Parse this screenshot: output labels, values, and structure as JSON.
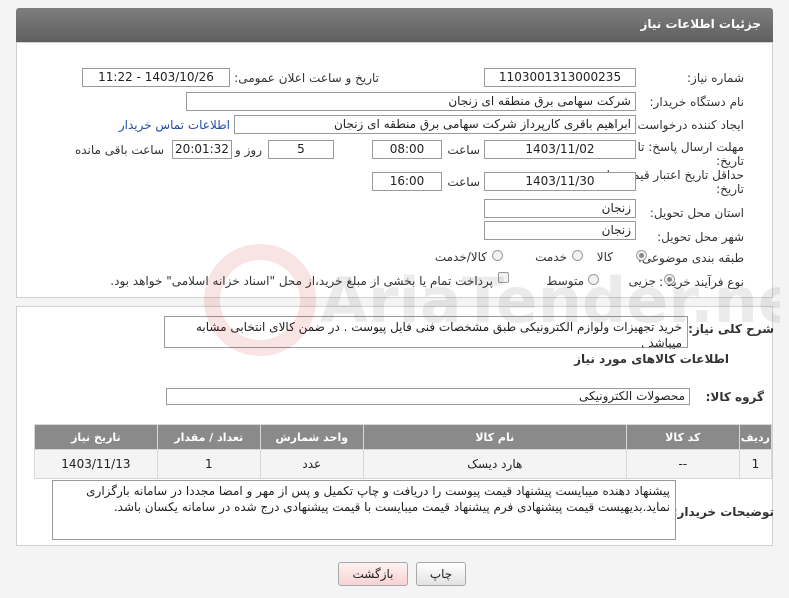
{
  "header": {
    "title": "جزئیات اطلاعات نیاز"
  },
  "form": {
    "need_number": {
      "label": "شماره نیاز:",
      "value": "1103001313000235"
    },
    "announce_datetime": {
      "label": "تاریخ و ساعت اعلان عمومی:",
      "value": "1403/10/26 - 11:22"
    },
    "buyer_org": {
      "label": "نام دستگاه خریدار:",
      "value": "شرکت سهامی برق منطقه ای زنجان"
    },
    "requester": {
      "label": "ایجاد کننده درخواست:",
      "value": "ابراهیم باقری کارپرداز شرکت سهامی برق منطقه ای زنجان",
      "contact_link": "اطلاعات تماس خریدار"
    },
    "reply_deadline": {
      "label_line1": "مهلت ارسال پاسخ: تا",
      "label_line2": "تاریخ:",
      "date": "1403/11/02",
      "time_label": "ساعت",
      "time": "08:00",
      "days": "5",
      "days_label": "روز و",
      "remaining": "20:01:32",
      "remaining_label": "ساعت باقی مانده"
    },
    "price_validity": {
      "label_line1": "حداقل تاریخ اعتبار قیمت: تا",
      "label_line2": "تاریخ:",
      "date": "1403/11/30",
      "time_label": "ساعت",
      "time": "16:00"
    },
    "province": {
      "label": "استان محل تحویل:",
      "value": "زنجان"
    },
    "city": {
      "label": "شهر محل تحویل:",
      "value": "زنجان"
    },
    "category": {
      "label": "طبقه بندی موضوعی:",
      "options": [
        "کالا",
        "خدمت",
        "کالا/خدمت"
      ],
      "selected": "کالا"
    },
    "process": {
      "label": "نوع فرآیند خرید :",
      "options": [
        "جزیی",
        "متوسط"
      ],
      "selected": "جزیی",
      "payment_note": "پرداخت تمام یا بخشی از مبلغ خرید،از محل \"اسناد خزانه اسلامی\" خواهد بود."
    }
  },
  "summary": {
    "label": "شرح کلی نیاز:",
    "text": "خرید تجهیزات ولوازم الکترونیکی طبق مشخصات فنی فایل پیوست . در ضمن کالای انتخابی مشابه میباشد ."
  },
  "goods_info": {
    "title": "اطلاعات کالاهای مورد نیاز"
  },
  "goods_group": {
    "label": "گروه کالا:",
    "value": "محصولات الکترونیکی"
  },
  "table": {
    "headers": [
      "ردیف",
      "کد کالا",
      "نام کالا",
      "واحد شمارش",
      "تعداد / مقدار",
      "تاریخ نیاز"
    ],
    "rows": [
      [
        "1",
        "--",
        "هارد دیسک",
        "عدد",
        "1",
        "1403/11/13"
      ]
    ]
  },
  "buyer_notes": {
    "label": "توضیحات خریدار:",
    "text": "پیشنهاد دهنده میبایست پیشنهاد قیمت پیوست را دریافت و چاپ تکمیل و  پس از مهر و امضا مجددا در سامانه بارگزاری نماید.بدیهیست قیمت پیشنهادی فرم پیشنهاد قیمت میبایست با قیمت پیشنهادی درج شده در سامانه یکسان باشد."
  },
  "buttons": {
    "print": "چاپ",
    "back": "بازگشت"
  },
  "watermark": {
    "text": "AriaTender.net"
  },
  "colors": {
    "header_bg": "#6e6e6e",
    "link": "#1f4fa6",
    "back_button_bg": "#fde3e3"
  }
}
